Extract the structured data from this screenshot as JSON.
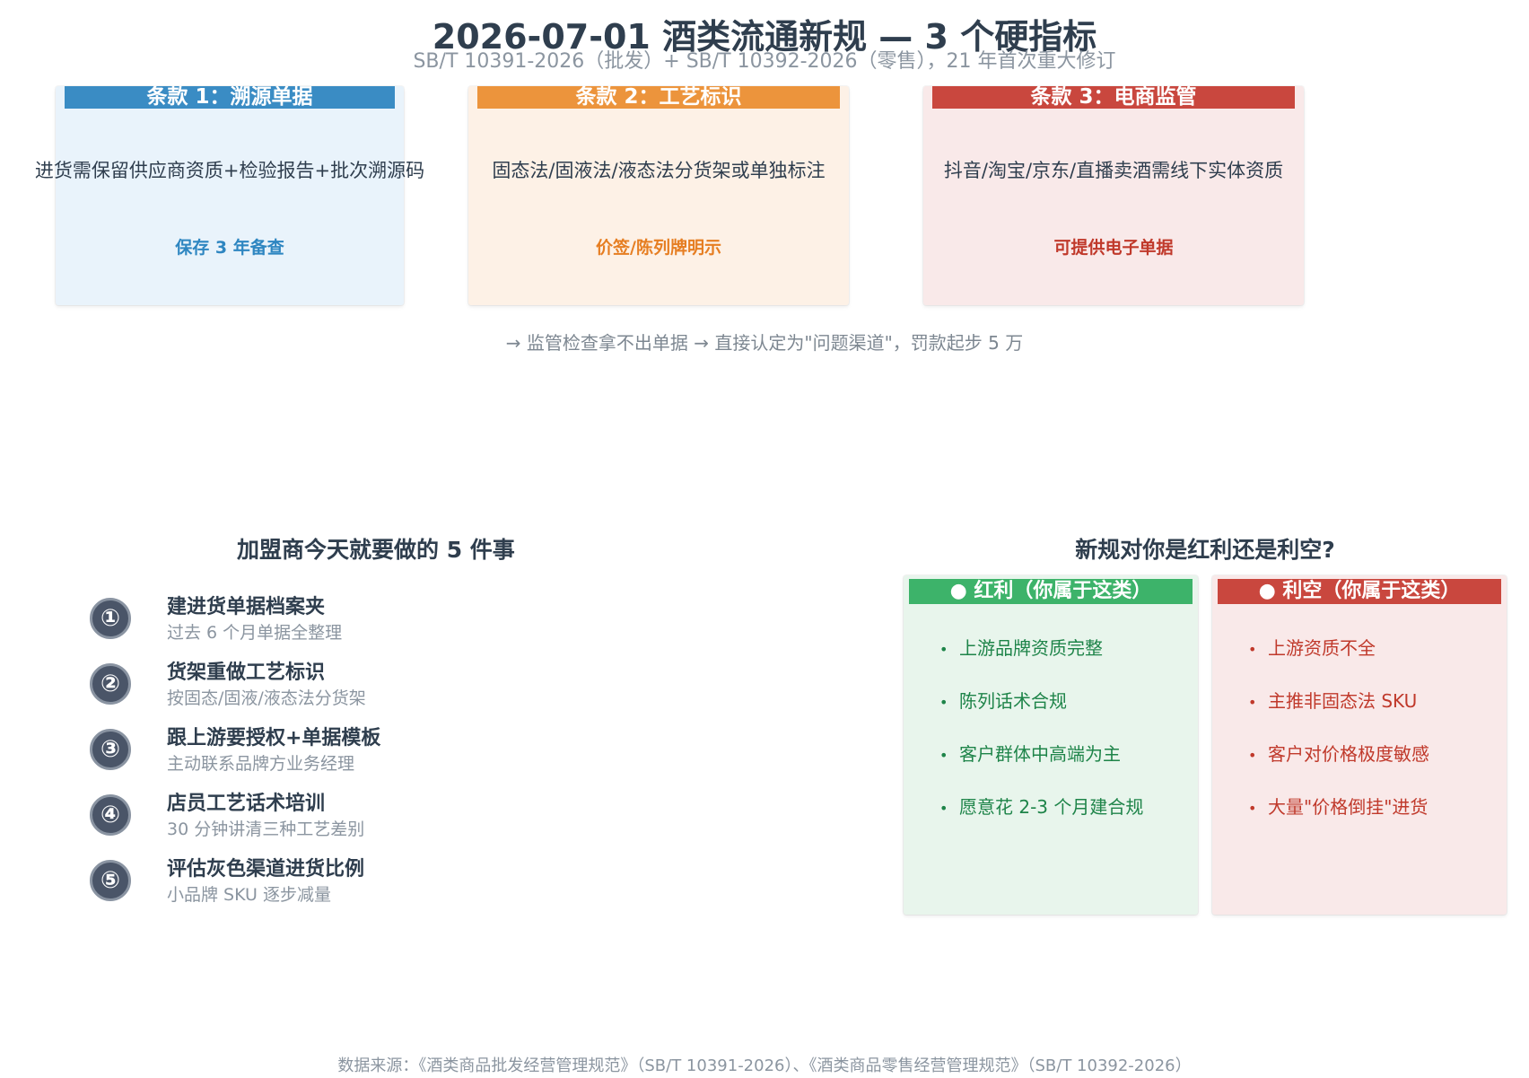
{
  "header": {
    "title": "2026-07-01 酒类流通新规 — 3 个硬指标",
    "subtitle": "SB/T 10391-2026（批发）+ SB/T 10392-2026（零售），21 年首次重大修订"
  },
  "clauses": [
    {
      "header": "条款 1：溯源单据",
      "body": "进货需保留供应商资质+检验报告+批次溯源码",
      "foot": "保存 3 年备查",
      "color": "#3a8cc4"
    },
    {
      "header": "条款 2：工艺标识",
      "body": "固态法/固液法/液态法分货架或单独标注",
      "foot": "价签/陈列牌明示",
      "color": "#ec943c"
    },
    {
      "header": "条款 3：电商监管",
      "body": "抖音/淘宝/京东/直播卖酒需线下实体资质",
      "foot": "可提供电子单据",
      "color": "#c9473e"
    }
  ],
  "warning": "→ 监管检查拿不出单据 → 直接认定为\"问题渠道\"，罚款起步 5 万",
  "todo": {
    "title": "加盟商今天就要做的 5 件事",
    "items": [
      {
        "num": "①",
        "title": "建进货单据档案夹",
        "sub": "过去 6 个月单据全整理"
      },
      {
        "num": "②",
        "title": "货架重做工艺标识",
        "sub": "按固态/固液/液态法分货架"
      },
      {
        "num": "③",
        "title": "跟上游要授权+单据模板",
        "sub": "主动联系品牌方业务经理"
      },
      {
        "num": "④",
        "title": "店员工艺话术培训",
        "sub": "30 分钟讲清三种工艺差别"
      },
      {
        "num": "⑤",
        "title": "评估灰色渠道进货比例",
        "sub": "小品牌 SKU 逐步减量"
      }
    ]
  },
  "verdict": {
    "title": "新规对你是红利还是利空?",
    "pros": {
      "header": "● 红利（你属于这类）",
      "items": [
        "上游品牌资质完整",
        "陈列话术合规",
        "客户群体中高端为主",
        "愿意花 2-3 个月建合规"
      ],
      "color": "#3db36a"
    },
    "cons": {
      "header": "● 利空（你属于这类）",
      "items": [
        "上游资质不全",
        "主推非固态法 SKU",
        "客户对价格极度敏感",
        "大量\"价格倒挂\"进货"
      ],
      "color": "#c9473e"
    },
    "bullet": "•"
  },
  "source": "数据来源：《酒类商品批发经营管理规范》（SB/T 10391-2026）、《酒类商品零售经营管理规范》（SB/T 10392-2026）"
}
